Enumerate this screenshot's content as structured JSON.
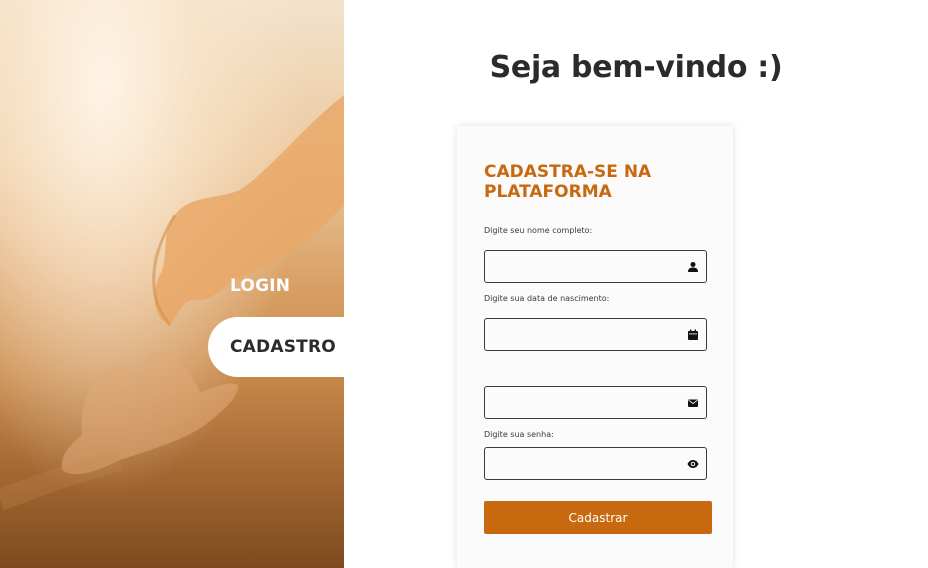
{
  "nav": {
    "login_label": "LOGIN",
    "cadastro_label": "CADASTRO"
  },
  "welcome": "Seja bem-vindo :)",
  "form": {
    "title": "CADASTRA-SE NA PLATAFORMA",
    "fields": [
      {
        "label": "Digite seu nome completo:",
        "value": "",
        "icon": "user-icon"
      },
      {
        "label": "Digite sua data de nascimento:",
        "value": "",
        "icon": "calendar-icon"
      },
      {
        "label": "",
        "value": "",
        "icon": "envelope-icon"
      },
      {
        "label": "Digite sua senha:",
        "value": "",
        "icon": "eye-icon"
      }
    ],
    "submit_label": "Cadastrar"
  },
  "colors": {
    "accent": "#c8690f",
    "text_dark": "#2b2b2b"
  }
}
